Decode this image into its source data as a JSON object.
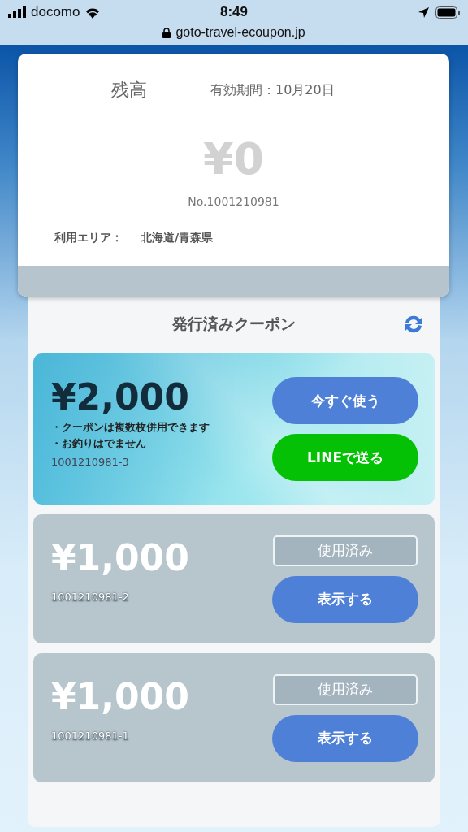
{
  "status_bar": {
    "carrier": "docomo",
    "time": "8:49",
    "url": "goto-travel-ecoupon.jp"
  },
  "balance": {
    "title": "残高",
    "expiry": "有効期間：10月20日",
    "amount": "¥0",
    "number": "No.1001210981",
    "area_label": "利用エリア：",
    "area": "北海道/青森県"
  },
  "coupons": {
    "title": "発行済みクーポン",
    "items": [
      {
        "kind": "active",
        "amount": "¥2,000",
        "notes": [
          "・クーポンは複数枚併用できます",
          "・お釣りはでません"
        ],
        "number": "1001210981-3",
        "buttons": [
          {
            "kind": "use",
            "label": "今すぐ使う"
          },
          {
            "kind": "line",
            "label": "LINEで送る"
          }
        ]
      },
      {
        "kind": "used",
        "amount": "¥1,000",
        "number": "1001210981-2",
        "status": "使用済み",
        "buttons": [
          {
            "kind": "show",
            "label": "表示する"
          }
        ]
      },
      {
        "kind": "used",
        "amount": "¥1,000",
        "number": "1001210981-1",
        "status": "使用済み",
        "buttons": [
          {
            "kind": "show",
            "label": "表示する"
          }
        ]
      }
    ]
  }
}
